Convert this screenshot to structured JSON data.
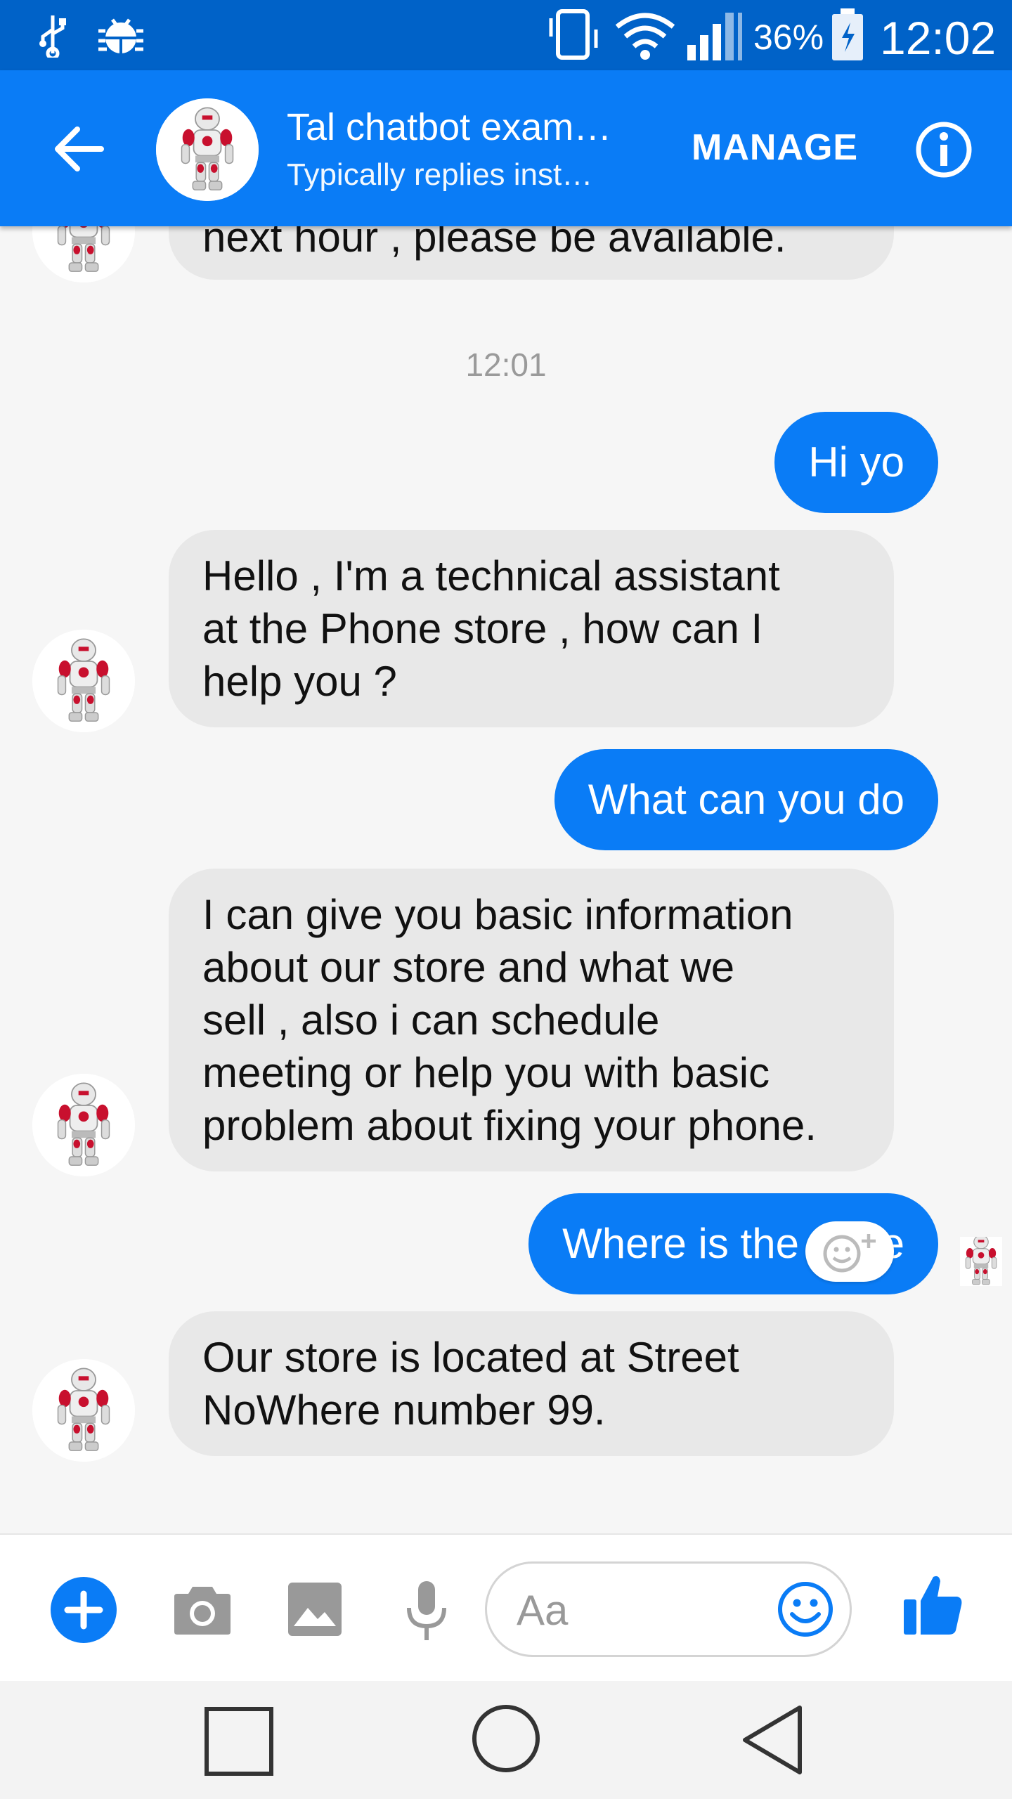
{
  "status_bar": {
    "battery_percent": "36%",
    "time": "12:02",
    "icons": [
      "usb-icon",
      "debug-icon",
      "vibrate-icon",
      "wifi-icon",
      "signal-icon",
      "battery-charging-icon"
    ]
  },
  "header": {
    "title": "Tal chatbot exam…",
    "subtitle": "Typically replies inst…",
    "manage_label": "MANAGE"
  },
  "conversation": {
    "partial_message": "next hour , please be available.",
    "timestamp": "12:01",
    "messages": [
      {
        "from": "user",
        "text": "Hi yo"
      },
      {
        "from": "bot",
        "lines": [
          "Hello , I'm a technical assistant",
          "at the Phone store , how can I",
          "help you ?"
        ]
      },
      {
        "from": "user",
        "text": "What can you do"
      },
      {
        "from": "bot",
        "lines": [
          "I can give you basic information",
          "about our store and what we",
          "sell , also i can schedule",
          "meeting or help you with basic",
          "problem about fixing your phone."
        ]
      },
      {
        "from": "user",
        "text": "Where is the store"
      },
      {
        "from": "bot",
        "lines": [
          "Our store is located at Street",
          "NoWhere number 99."
        ]
      }
    ]
  },
  "composer": {
    "placeholder": "Aa"
  },
  "colors": {
    "status_bar": "#0062c8",
    "accent": "#0a7cf6",
    "bot_bubble": "#e8e8e8"
  }
}
